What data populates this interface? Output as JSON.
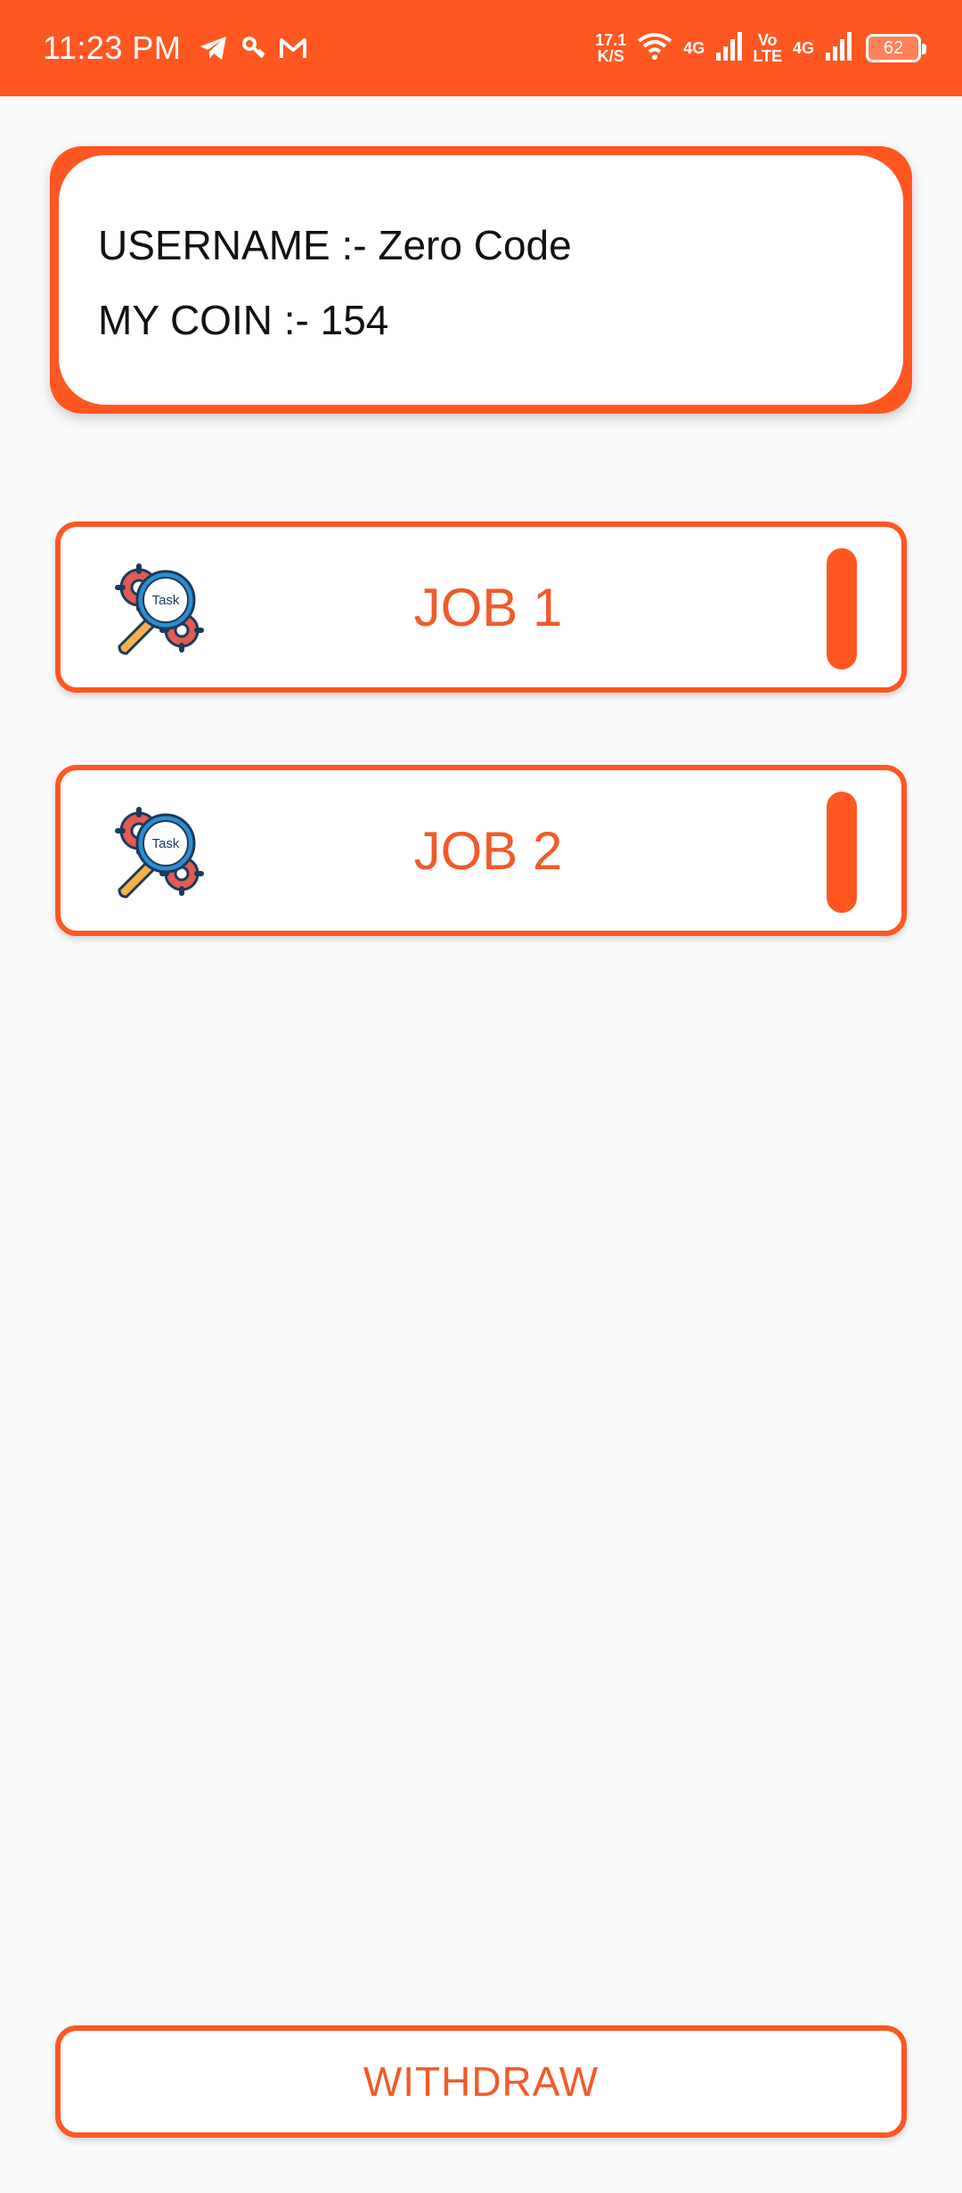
{
  "status_bar": {
    "time": "11:23 PM",
    "speed_value": "17.1",
    "speed_unit": "K/S",
    "net1": "4G",
    "volte_top": "Vo",
    "volte_bottom": "LTE",
    "net2": "4G",
    "battery": "62",
    "icons": [
      "telegram-icon",
      "key-icon",
      "gmail-icon",
      "wifi-icon",
      "signal-icon",
      "battery-icon"
    ]
  },
  "profile": {
    "username_line": "USERNAME :- Zero Code",
    "coin_line": "MY COIN :- 154"
  },
  "jobs": [
    {
      "label": "JOB 1",
      "icon": "task-search-icon",
      "icon_text": "Task"
    },
    {
      "label": "JOB 2",
      "icon": "task-search-icon",
      "icon_text": "Task"
    }
  ],
  "withdraw": {
    "label": "WITHDRAW"
  },
  "colors": {
    "accent": "#ff5722",
    "accent_text": "#f15a2a",
    "background": "#fafafa"
  }
}
